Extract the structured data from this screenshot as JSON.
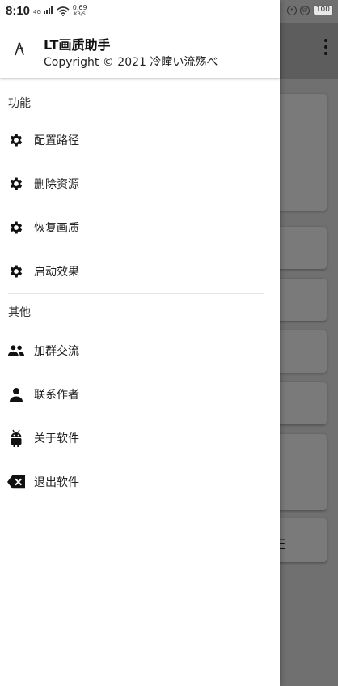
{
  "status_bar": {
    "time": "8:10",
    "network": "4G",
    "speed_value": "0.69",
    "speed_unit": "KB/S",
    "battery": "100"
  },
  "drawer": {
    "app_name": "LT画质助手",
    "copyright": "Copyright © 2021 冷瞳い流殇べ",
    "sections": {
      "functions": {
        "title": "功能",
        "items": [
          {
            "label": "配置路径",
            "icon": "gear-icon"
          },
          {
            "label": "删除资源",
            "icon": "gear-icon"
          },
          {
            "label": "恢复画质",
            "icon": "gear-icon"
          },
          {
            "label": "启动效果",
            "icon": "gear-icon"
          }
        ]
      },
      "other": {
        "title": "其他",
        "items": [
          {
            "label": "加群交流",
            "icon": "group-icon"
          },
          {
            "label": "联系作者",
            "icon": "person-icon"
          },
          {
            "label": "关于软件",
            "icon": "android-icon"
          },
          {
            "label": "退出软件",
            "icon": "backspace-icon"
          }
        ]
      }
    }
  },
  "background_app": {
    "visible_glyph": "E"
  },
  "colors": {
    "drawer_bg": "#ffffff",
    "scrim": "#707070",
    "icon": "#111111"
  }
}
